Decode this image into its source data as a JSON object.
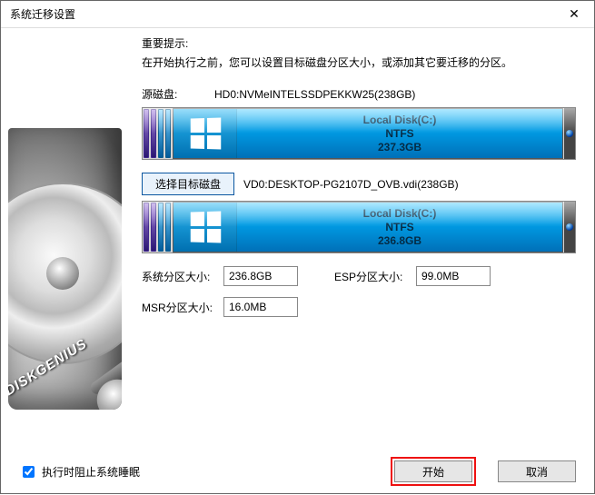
{
  "window": {
    "title": "系统迁移设置"
  },
  "tip": {
    "heading": "重要提示:",
    "body": "在开始执行之前，您可以设置目标磁盘分区大小，或添加其它要迁移的分区。"
  },
  "source": {
    "label": "源磁盘:",
    "value": "HD0:NVMeINTELSSDPEKKW25(238GB)",
    "partition": {
      "name": "Local Disk(C:)",
      "fs": "NTFS",
      "size": "237.3GB"
    }
  },
  "target": {
    "select_button": "选择目标磁盘",
    "value": "VD0:DESKTOP-PG2107D_OVB.vdi(238GB)",
    "partition": {
      "name": "Local Disk(C:)",
      "fs": "NTFS",
      "size": "236.8GB"
    }
  },
  "fields": {
    "system_size_label": "系统分区大小:",
    "system_size_value": "236.8GB",
    "msr_size_label": "MSR分区大小:",
    "msr_size_value": "16.0MB",
    "esp_size_label": "ESP分区大小:",
    "esp_size_value": "99.0MB"
  },
  "footer": {
    "prevent_sleep_label": "执行时阻止系统睡眠",
    "prevent_sleep_checked": true,
    "start_label": "开始",
    "cancel_label": "取消"
  },
  "branding": "DISKGENIUS"
}
